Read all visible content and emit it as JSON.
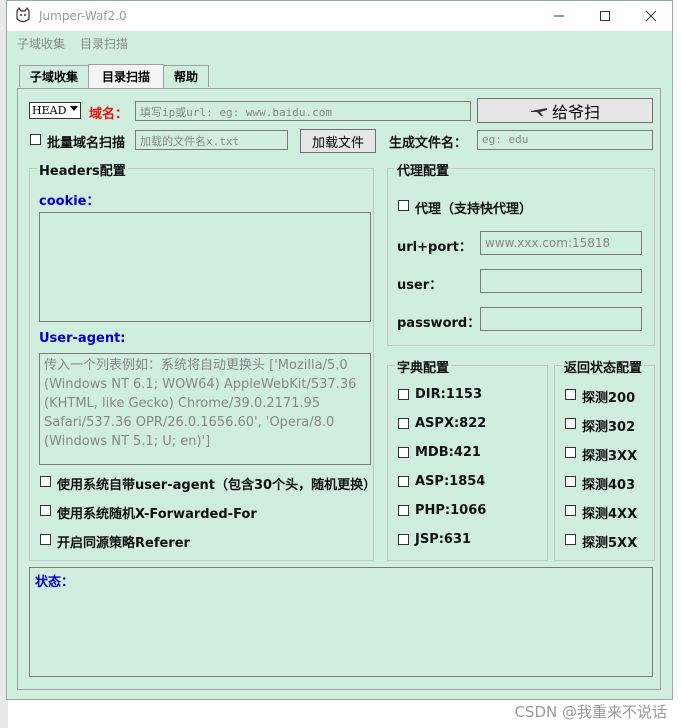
{
  "window": {
    "title": "Jumper-Waf2.0"
  },
  "menu": [
    "子域收集",
    "目录扫描"
  ],
  "tabs": [
    "子域收集",
    "目录扫描",
    "帮助"
  ],
  "form": {
    "method_value": "HEAD",
    "domain_label": "域名：",
    "domain_placeholder": "填写ip或url: eg: www.baidu.com",
    "scan_button": "给爷扫",
    "batch_label": "批量域名扫描",
    "file_placeholder": "加载的文件名x.txt",
    "load_button": "加载文件",
    "gen_label": "生成文件名：",
    "gen_placeholder": "eg: edu"
  },
  "headers": {
    "title": "Headers配置",
    "cookie_label": "cookie：",
    "ua_label": "User-agent:",
    "ua_placeholder": "传入一个列表例如：系统将自动更换头 ['Mozilla/5.0 (Windows NT 6.1; WOW64) AppleWebKit/537.36 (KHTML, like Gecko) Chrome/39.0.2171.95 Safari/537.36 OPR/26.0.1656.60', 'Opera/8.0 (Windows NT 5.1; U; en)']",
    "options": [
      "使用系统自带user-agent（包含30个头，随机更换）",
      "使用系统随机X-Forwarded-For",
      "开启同源策略Referer"
    ]
  },
  "proxy": {
    "title": "代理配置",
    "check_label": "代理（支持快代理）",
    "url_label": "url+port：",
    "url_placeholder": "www.xxx.com:15818",
    "user_label": "user：",
    "password_label": "password："
  },
  "dict": {
    "title": "字典配置",
    "items": [
      "DIR:1153",
      "ASPX:822",
      "MDB:421",
      "ASP:1854",
      "PHP:1066",
      "JSP:631"
    ]
  },
  "status_cfg": {
    "title": "返回状态配置",
    "items": [
      "探测200",
      "探测302",
      "探测3XX",
      "探测403",
      "探测4XX",
      "探测5XX"
    ]
  },
  "status": {
    "label": "状态："
  },
  "watermark": "CSDN @我重来不说话",
  "colors": {
    "bg": "#cfeedd",
    "accent_blue": "#0000cc",
    "domain_red": "#ee1111"
  }
}
